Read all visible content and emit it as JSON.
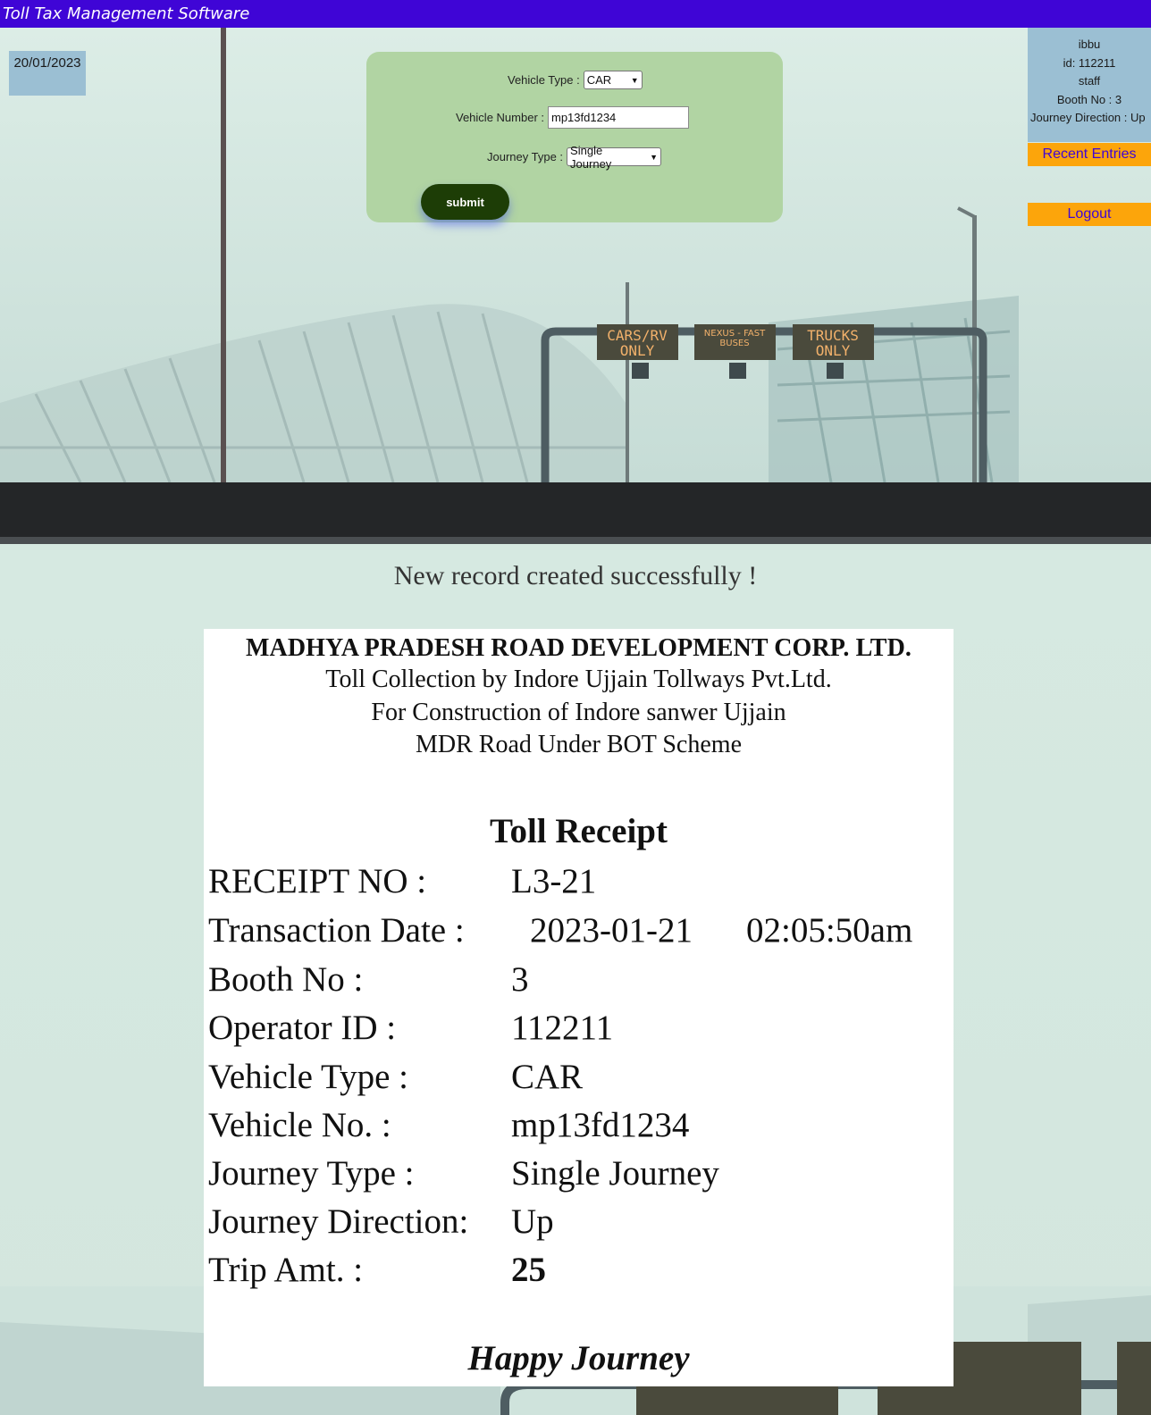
{
  "app": {
    "title": "Toll Tax Management Software"
  },
  "date": "20/01/2023",
  "form": {
    "vehicle_type_label": "Vehicle Type :",
    "vehicle_type_value": "CAR",
    "vehicle_number_label": "Vehicle Number :",
    "vehicle_number_value": "mp13fd1234",
    "journey_type_label": "Journey Type :",
    "journey_type_value": "Single Journey",
    "submit_label": "submit"
  },
  "user": {
    "name": "ibbu",
    "id_line": "id: 112211",
    "role": "staff",
    "booth_line": "Booth No : 3",
    "direction_line": "Journey Direction : Up"
  },
  "nav": {
    "recent_entries": "Recent Entries",
    "logout": "Logout"
  },
  "scene_signs": {
    "sign1": [
      "CARS/RV",
      "ONLY"
    ],
    "sign2": [
      "NEXUS - FAST",
      "BUSES"
    ],
    "sign3": [
      "TRUCKS",
      "ONLY"
    ]
  },
  "message": "New record created successfully !",
  "receipt": {
    "corp": "MADHYA PRADESH ROAD DEVELOPMENT CORP. LTD.",
    "line1": "Toll Collection by Indore Ujjain Tollways Pvt.Ltd.",
    "line2": "For Construction of Indore sanwer Ujjain",
    "line3": "MDR Road Under BOT Scheme",
    "title": "Toll Receipt",
    "rows": [
      {
        "label": "RECEIPT NO :",
        "value": "L3-21"
      },
      {
        "label": "Transaction Date :",
        "value": "2023-01-21",
        "value2": "02:05:50am"
      },
      {
        "label": "Booth No :",
        "value": "3"
      },
      {
        "label": "Operator ID :",
        "value": "112211"
      },
      {
        "label": "Vehicle Type :",
        "value": "CAR"
      },
      {
        "label": "Vehicle No. :",
        "value": "mp13fd1234"
      },
      {
        "label": "Journey Type :",
        "value": "Single Journey"
      },
      {
        "label": "Journey Direction:",
        "value": "Up"
      },
      {
        "label": "Trip Amt. :",
        "value": "25"
      }
    ],
    "footer": "Happy Journey"
  },
  "colors": {
    "topbar": "#3f05d6",
    "accent_button": "#fca50b",
    "submit": "#1d3d06",
    "form_bg": "#b1d4a3",
    "panel_bg": "#9bbfd3"
  }
}
